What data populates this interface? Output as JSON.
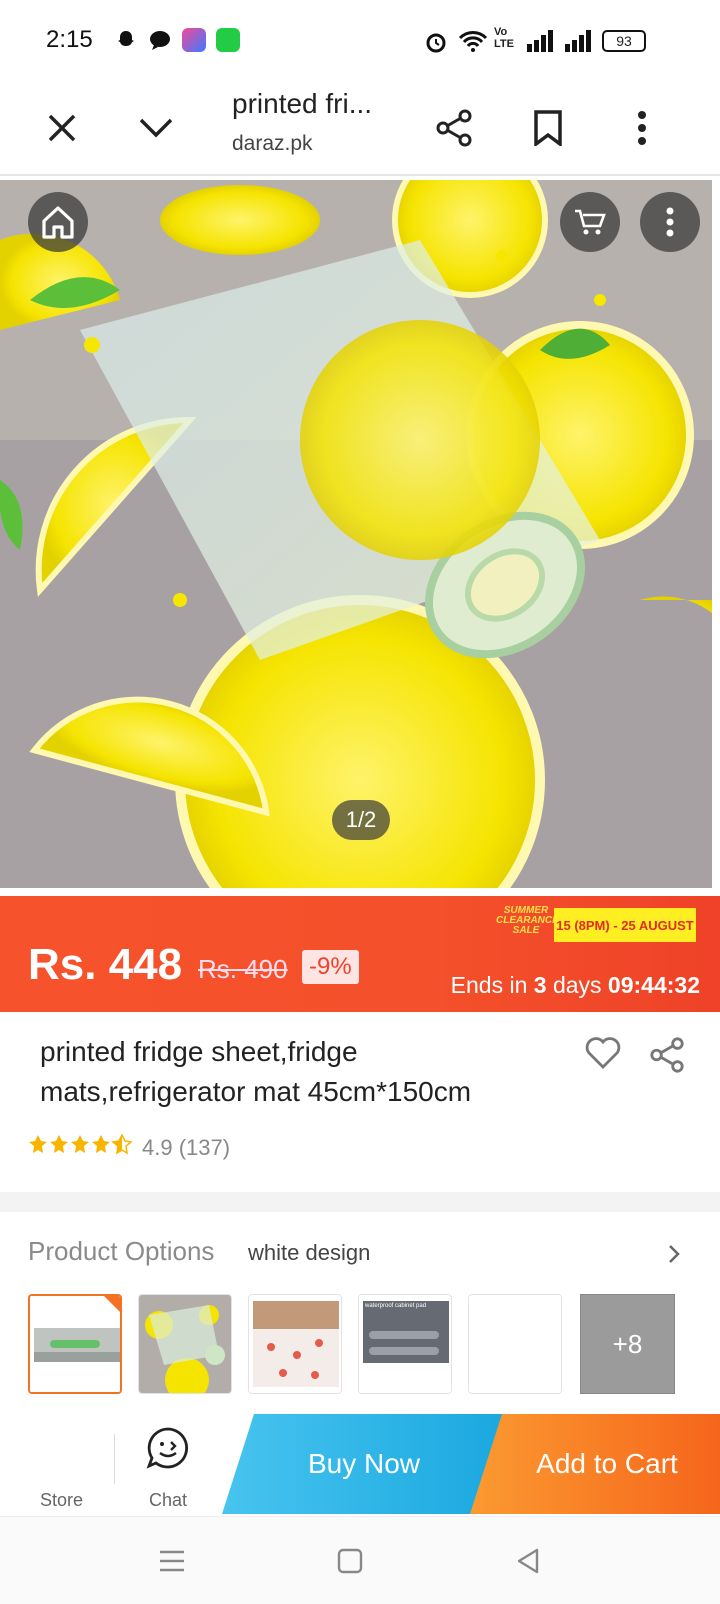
{
  "status_bar": {
    "time": "2:15",
    "battery": "93",
    "network_label": "Vo LTE"
  },
  "browser": {
    "page_title": "printed fri...",
    "domain": "daraz.pk",
    "icons": [
      "close-icon",
      "chevron-down-icon",
      "share-icon",
      "bookmark-icon",
      "more-vert-icon"
    ]
  },
  "hero": {
    "image_counter": "1/2",
    "icons": [
      "home-icon",
      "cart-icon",
      "more-vert-icon"
    ]
  },
  "price": {
    "current": "Rs. 448",
    "original": "Rs. 490",
    "discount": "-9%",
    "sale_badge": "SUMMER CLEARANCE SALE",
    "sale_dates": "15 (8PM) - 25 AUGUST",
    "ends_prefix": "Ends in",
    "ends_days": "3",
    "ends_days_unit": "days",
    "ends_time": "09:44:32"
  },
  "product": {
    "title": "printed fridge sheet,fridge mats,refrigerator mat 45cm*150cm",
    "rating": "4.9",
    "review_count": "(137)",
    "stars_shown": 4.5
  },
  "options": {
    "label": "Product Options",
    "selected": "white design",
    "more_count": "+8",
    "thumb_captions": [
      "",
      "",
      "",
      "waterproof cabinet pad",
      ""
    ]
  },
  "bottom_bar": {
    "store_label": "Store",
    "chat_label": "Chat",
    "buy_now": "Buy Now",
    "add_to_cart": "Add to Cart"
  },
  "colors": {
    "accent_orange": "#f57224",
    "price_band": "#f4502b",
    "buy_now": "#1aa8e0",
    "star": "#f7b500"
  }
}
